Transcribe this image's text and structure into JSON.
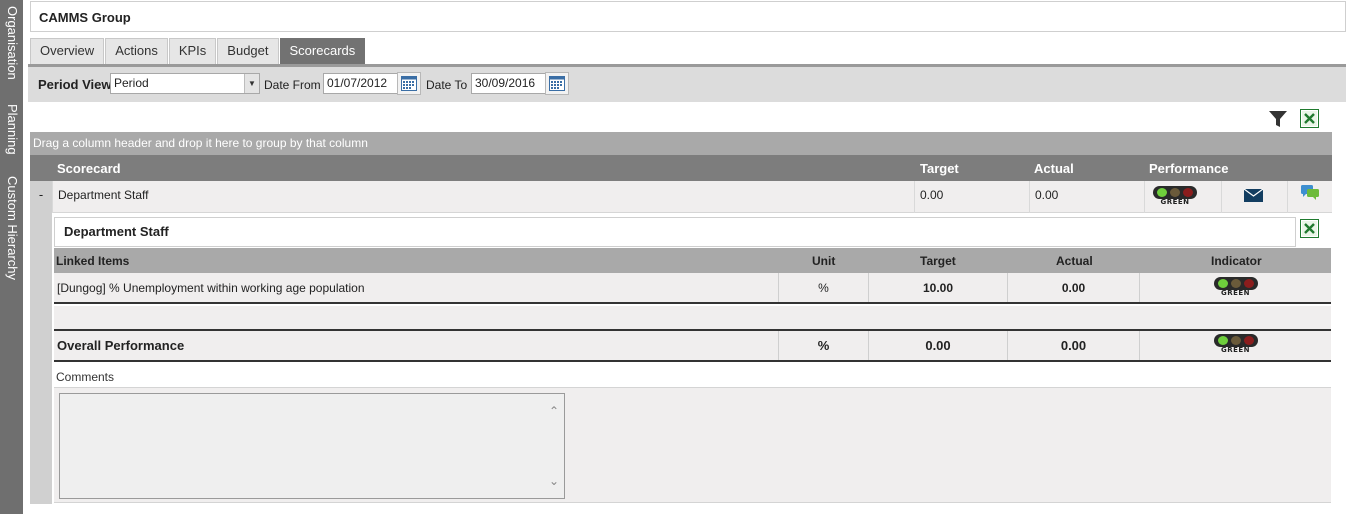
{
  "side_tabs": [
    "Organisation",
    "Planning",
    "Custom Hierarchy"
  ],
  "header": {
    "title": "CAMMS Group"
  },
  "tabs": [
    {
      "label": "Overview"
    },
    {
      "label": "Actions"
    },
    {
      "label": "KPIs"
    },
    {
      "label": "Budget"
    },
    {
      "label": "Scorecards",
      "active": true
    }
  ],
  "filters": {
    "period_view_label": "Period View",
    "period_value": "Period",
    "date_from_label": "Date From",
    "date_from": "01/07/2012",
    "date_to_label": "Date To",
    "date_to": "30/09/2016"
  },
  "grid": {
    "group_hint": "Drag a column header and drop it here to group by that column",
    "columns": {
      "scorecard": "Scorecard",
      "target": "Target",
      "actual": "Actual",
      "performance": "Performance"
    },
    "row": {
      "expander": "-",
      "scorecard": "Department Staff",
      "target": "0.00",
      "actual": "0.00",
      "indicator": "GREEN"
    }
  },
  "detail": {
    "title": "Department Staff",
    "columns": {
      "linked_items": "Linked Items",
      "unit": "Unit",
      "target": "Target",
      "actual": "Actual",
      "indicator": "Indicator"
    },
    "items": [
      {
        "name": "[Dungog] % Unemployment within working age population",
        "unit": "%",
        "target": "10.00",
        "actual": "0.00",
        "indicator": "GREEN"
      }
    ],
    "overall": {
      "label": "Overall Performance",
      "unit": "%",
      "target": "0.00",
      "actual": "0.00",
      "indicator": "GREEN"
    },
    "comments_label": "Comments",
    "comments_value": ""
  },
  "colors": {
    "tab_active": "#727272",
    "grid_header": "#7d7d7d",
    "traffic_green": "#6fcf3c"
  }
}
